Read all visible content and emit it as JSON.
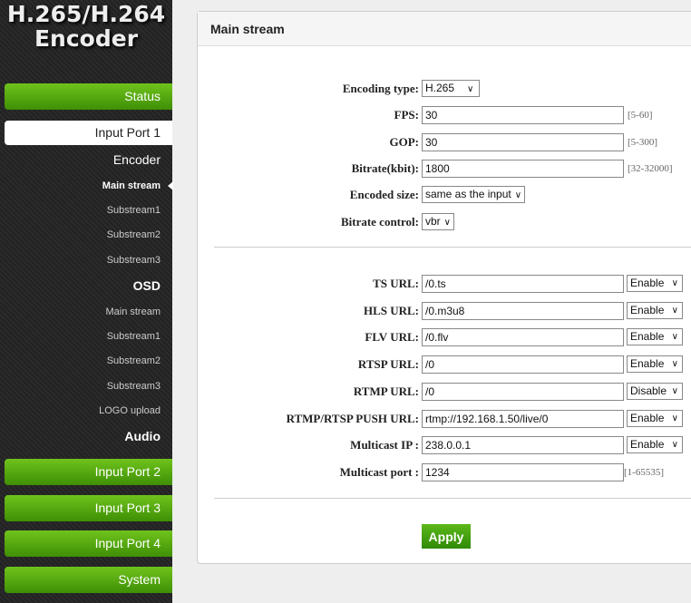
{
  "logo": {
    "line1": "H.265/H.264",
    "line2": "Encoder"
  },
  "sidebar": {
    "status": "Status",
    "input_port_1": "Input Port 1",
    "encoder": "Encoder",
    "encoder_items": [
      "Main stream",
      "Substream1",
      "Substream2",
      "Substream3"
    ],
    "osd": "OSD",
    "osd_items": [
      "Main stream",
      "Substream1",
      "Substream2",
      "Substream3",
      "LOGO upload"
    ],
    "audio": "Audio",
    "input_port_2": "Input Port 2",
    "input_port_3": "Input Port 3",
    "input_port_4": "Input Port 4",
    "system": "System"
  },
  "panel": {
    "title": "Main stream",
    "encoding": {
      "encoding_type_label": "Encoding type:",
      "encoding_type": "H.265",
      "fps_label": "FPS:",
      "fps": "30",
      "fps_range": "[5-60]",
      "gop_label": "GOP:",
      "gop": "30",
      "gop_range": "[5-300]",
      "bitrate_label": "Bitrate(kbit):",
      "bitrate": "1800",
      "bitrate_range": "[32-32000]",
      "size_label": "Encoded size:",
      "size": "same as the input",
      "control_label": "Bitrate control:",
      "control": "vbr"
    },
    "urls": [
      {
        "label": "TS URL:",
        "value": "/0.ts",
        "state": "Enable"
      },
      {
        "label": "HLS URL:",
        "value": "/0.m3u8",
        "state": "Enable"
      },
      {
        "label": "FLV URL:",
        "value": "/0.flv",
        "state": "Enable"
      },
      {
        "label": "RTSP URL:",
        "value": "/0",
        "state": "Enable"
      },
      {
        "label": "RTMP URL:",
        "value": "/0",
        "state": "Disable"
      },
      {
        "label": "RTMP/RTSP PUSH URL:",
        "value": "rtmp://192.168.1.50/live/0",
        "state": "Enable"
      },
      {
        "label": "Multicast IP :",
        "value": "238.0.0.1",
        "state": "Enable"
      }
    ],
    "multicast_port_label": "Multicast port :",
    "multicast_port": "1234",
    "multicast_port_range": "[1-65535]",
    "apply": "Apply"
  }
}
